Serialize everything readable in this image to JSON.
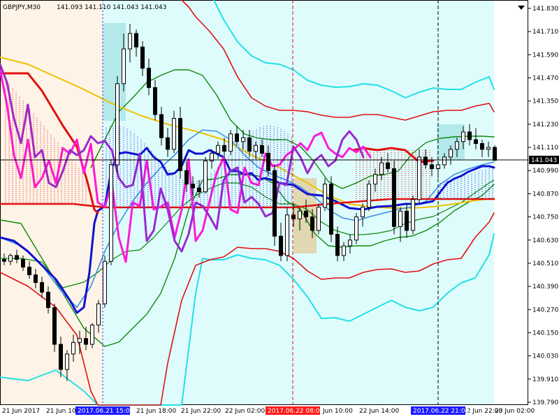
{
  "header": {
    "symbol_tf": "GBPJPY,M30",
    "ohlc": "141.093 141.110 141.043 141.043"
  },
  "colors": {
    "background": "#ffffff",
    "panel_left": "#fdf3e6",
    "panel_right": "#dffcfc",
    "bull_candle": "#ffffff",
    "bear_candle": "#000000",
    "current_price_bg": "#000000",
    "date_tag_blue": "#1a1aff",
    "date_tag_red": "#ff1a1a"
  },
  "price_axis": {
    "ticks": [
      "141.830",
      "141.710",
      "141.590",
      "141.470",
      "141.350",
      "141.230",
      "141.110",
      "140.990",
      "140.870",
      "140.750",
      "140.630",
      "140.510",
      "140.390",
      "140.270",
      "140.150",
      "140.030",
      "139.910",
      "139.790"
    ],
    "current_price": "141.043"
  },
  "time_axis": {
    "labels": [
      "21 Jun 2017",
      "21 Jun 10",
      "21 Jun 18:00",
      "21 Jun 22:00",
      "22 Jun 02:00",
      "Jun 10:00",
      "22 Jun 14:00",
      "22 Jun 22:00",
      "23 Jun 02:00"
    ],
    "tag_blue_1": "2017.06.21 15:00",
    "tag_red": "2017.06.22 08:00",
    "tag_blue_2": "2017.06.22 21:00"
  },
  "chart_data": {
    "type": "candlestick",
    "symbol": "GBPJPY",
    "timeframe": "M30",
    "ylim": [
      139.79,
      141.83
    ],
    "last_price": 141.043,
    "candles": [
      [
        140.53,
        140.56,
        140.5,
        140.52
      ],
      [
        140.52,
        140.56,
        140.5,
        140.55
      ],
      [
        140.55,
        140.58,
        140.51,
        140.53
      ],
      [
        140.53,
        140.55,
        140.47,
        140.49
      ],
      [
        140.49,
        140.52,
        140.43,
        140.45
      ],
      [
        140.45,
        140.48,
        140.38,
        140.41
      ],
      [
        140.41,
        140.44,
        140.33,
        140.36
      ],
      [
        140.36,
        140.39,
        140.25,
        140.28
      ],
      [
        140.28,
        140.3,
        140.05,
        140.09
      ],
      [
        140.09,
        140.13,
        139.92,
        139.96
      ],
      [
        139.96,
        140.06,
        139.9,
        140.04
      ],
      [
        140.04,
        140.14,
        140.0,
        140.1
      ],
      [
        140.1,
        140.16,
        140.04,
        140.12
      ],
      [
        140.12,
        140.18,
        140.06,
        140.09
      ],
      [
        140.09,
        140.2,
        140.07,
        140.19
      ],
      [
        140.19,
        140.32,
        140.15,
        140.3
      ],
      [
        140.3,
        140.55,
        140.28,
        140.52
      ],
      [
        140.52,
        141.05,
        140.5,
        141.02
      ],
      [
        141.02,
        141.48,
        140.98,
        141.44
      ],
      [
        141.44,
        141.7,
        141.4,
        141.62
      ],
      [
        141.62,
        141.75,
        141.55,
        141.7
      ],
      [
        141.7,
        141.72,
        141.58,
        141.63
      ],
      [
        141.63,
        141.66,
        141.48,
        141.52
      ],
      [
        141.52,
        141.57,
        141.38,
        141.42
      ],
      [
        141.42,
        141.46,
        141.25,
        141.28
      ],
      [
        141.28,
        141.32,
        141.12,
        141.16
      ],
      [
        141.16,
        141.21,
        141.06,
        141.1
      ],
      [
        141.1,
        141.3,
        141.08,
        141.26
      ],
      [
        141.26,
        141.32,
        140.95,
        140.99
      ],
      [
        140.99,
        141.04,
        140.88,
        140.92
      ],
      [
        140.92,
        140.96,
        140.86,
        140.9
      ],
      [
        140.9,
        140.94,
        140.85,
        140.88
      ],
      [
        140.88,
        141.06,
        140.87,
        141.04
      ],
      [
        141.04,
        141.1,
        141.0,
        141.08
      ],
      [
        141.08,
        141.14,
        141.05,
        141.12
      ],
      [
        141.12,
        141.16,
        141.06,
        141.09
      ],
      [
        141.09,
        141.2,
        141.07,
        141.18
      ],
      [
        141.18,
        141.22,
        141.12,
        141.14
      ],
      [
        141.14,
        141.2,
        141.1,
        141.16
      ],
      [
        141.16,
        141.2,
        141.06,
        141.09
      ],
      [
        141.09,
        141.14,
        141.05,
        141.12
      ],
      [
        141.12,
        141.15,
        141.06,
        141.08
      ],
      [
        141.08,
        141.12,
        140.96,
        140.99
      ],
      [
        140.99,
        141.02,
        140.6,
        140.65
      ],
      [
        140.65,
        140.72,
        140.52,
        140.55
      ],
      [
        140.55,
        140.8,
        140.52,
        140.76
      ],
      [
        140.76,
        140.82,
        140.7,
        140.74
      ],
      [
        140.74,
        140.8,
        140.68,
        140.78
      ],
      [
        140.78,
        140.84,
        140.72,
        140.75
      ],
      [
        140.75,
        140.79,
        140.64,
        140.68
      ],
      [
        140.68,
        140.82,
        140.66,
        140.8
      ],
      [
        140.8,
        140.95,
        140.78,
        140.92
      ],
      [
        140.92,
        140.96,
        140.62,
        140.66
      ],
      [
        140.66,
        140.7,
        140.52,
        140.55
      ],
      [
        140.55,
        140.62,
        140.52,
        140.6
      ],
      [
        140.6,
        140.66,
        140.56,
        140.63
      ],
      [
        140.63,
        140.77,
        140.61,
        140.75
      ],
      [
        140.75,
        140.82,
        140.7,
        140.8
      ],
      [
        140.8,
        140.94,
        140.78,
        140.92
      ],
      [
        140.92,
        141.0,
        140.88,
        140.97
      ],
      [
        140.97,
        141.06,
        140.94,
        141.03
      ],
      [
        141.03,
        141.08,
        140.98,
        141.0
      ],
      [
        141.0,
        141.04,
        140.66,
        140.7
      ],
      [
        140.7,
        140.8,
        140.62,
        140.78
      ],
      [
        140.78,
        140.82,
        140.64,
        140.68
      ],
      [
        140.68,
        140.86,
        140.66,
        140.84
      ],
      [
        140.84,
        141.1,
        140.82,
        141.06
      ],
      [
        141.06,
        141.1,
        141.0,
        141.02
      ],
      [
        141.02,
        141.06,
        140.96,
        141.0
      ],
      [
        141.0,
        141.04,
        140.95,
        141.02
      ],
      [
        141.02,
        141.08,
        141.0,
        141.06
      ],
      [
        141.06,
        141.12,
        141.02,
        141.1
      ],
      [
        141.1,
        141.16,
        141.06,
        141.14
      ],
      [
        141.14,
        141.22,
        141.1,
        141.19
      ],
      [
        141.19,
        141.23,
        141.12,
        141.15
      ],
      [
        141.15,
        141.21,
        141.1,
        141.13
      ],
      [
        141.13,
        141.15,
        141.06,
        141.1
      ],
      [
        141.1,
        141.14,
        141.06,
        141.11
      ],
      [
        141.11,
        141.12,
        141.04,
        141.043
      ]
    ]
  }
}
